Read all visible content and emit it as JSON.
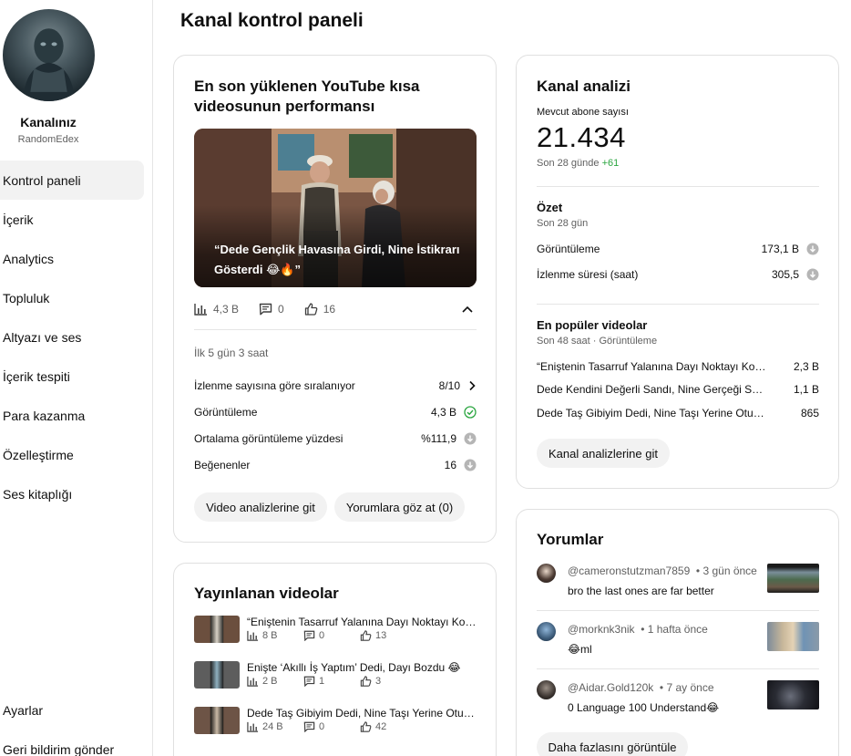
{
  "page_title": "Kanal kontrol paneli",
  "sidebar": {
    "channel_name": "Kanalınız",
    "channel_handle": "RandomEdex",
    "items": [
      {
        "label": "Kontrol paneli",
        "active": true
      },
      {
        "label": "İçerik"
      },
      {
        "label": "Analytics"
      },
      {
        "label": "Topluluk"
      },
      {
        "label": "Altyazı ve ses"
      },
      {
        "label": "İçerik tespiti"
      },
      {
        "label": "Para kazanma"
      },
      {
        "label": "Özelleştirme"
      },
      {
        "label": "Ses kitaplığı"
      }
    ],
    "settings": "Ayarlar",
    "feedback": "Geri bildirim gönder"
  },
  "shorts_card": {
    "title": "En son yüklenen YouTube kısa videosunun performansı",
    "thumbnail_caption": "“Dede Gençlik Havasına Girdi, Nine İstikrarı Gösterdi 😂🔥”",
    "stats": {
      "views": "4,3 B",
      "comments": "0",
      "likes": "16"
    },
    "period": "İlk 5 gün 3 saat",
    "metrics": [
      {
        "label": "İzlenme sayısına göre sıralanıyor",
        "value": "8/10",
        "icon": "chevron-right-icon"
      },
      {
        "label": "Görüntüleme",
        "value": "4,3 B",
        "icon": "check-circle-icon"
      },
      {
        "label": "Ortalama görüntüleme yüzdesi",
        "value": "%111,9",
        "icon": "arrow-down-circle-icon"
      },
      {
        "label": "Beğenenler",
        "value": "16",
        "icon": "arrow-down-circle-icon"
      }
    ],
    "btn_video_analytics": "Video analizlerine git",
    "btn_comments": "Yorumlara göz at (0)"
  },
  "videos_card": {
    "title": "Yayınlanan videolar",
    "items": [
      {
        "title": "“Eniştenin Tasarruf Yalanına Dayı Noktayı Koydu 😂”",
        "views": "8 B",
        "comments": "0",
        "likes": "13"
      },
      {
        "title": "Enişte ‘Akıllı İş Yaptım’ Dedi, Dayı Bozdu 😂",
        "views": "2 B",
        "comments": "1",
        "likes": "3"
      },
      {
        "title": "Dede Taş Gibiyim Dedi, Nine Taşı Yerine Oturttu 😂🔥",
        "views": "24 B",
        "comments": "0",
        "likes": "42"
      }
    ]
  },
  "analytics_card": {
    "title": "Kanal analizi",
    "subs_label": "Mevcut abone sayısı",
    "subs_count": "21.434",
    "subs_period": "Son 28 günde",
    "subs_gain": "+61",
    "summary_title": "Özet",
    "summary_period": "Son 28 gün",
    "summary": [
      {
        "label": "Görüntüleme",
        "value": "173,1 B"
      },
      {
        "label": "İzlenme süresi (saat)",
        "value": "305,5"
      }
    ],
    "top_title": "En popüler videolar",
    "top_period": "Son 48 saat · Görüntüleme",
    "top_videos": [
      {
        "title": "“Eniştenin Tasarruf Yalanına Dayı Noktayı Koydu 😂”",
        "value": "2,3 B"
      },
      {
        "title": "Dede Kendini Değerli Sandı, Nine Gerçeği Söyledi 😂",
        "value": "1,1 B"
      },
      {
        "title": "Dede Taş Gibiyim Dedi, Nine Taşı Yerine Oturttu 😂🔥",
        "value": "865"
      }
    ],
    "btn": "Kanal analizlerine git"
  },
  "comments_card": {
    "title": "Yorumlar",
    "items": [
      {
        "author": "@cameronstutzman7859",
        "time": "• 3 gün önce",
        "text": "bro the last ones are far better"
      },
      {
        "author": "@morknk3nik",
        "time": "• 1 hafta önce",
        "text": "😂ml"
      },
      {
        "author": "@Aidar.Gold120k",
        "time": "• 7 ay önce",
        "text": "0 Language 100 Understand😂"
      }
    ],
    "btn": "Daha fazlasını görüntüle"
  },
  "colors": {
    "accent_green": "#2ba640",
    "muted": "#606060",
    "pill_bg": "#f2f2f2"
  }
}
